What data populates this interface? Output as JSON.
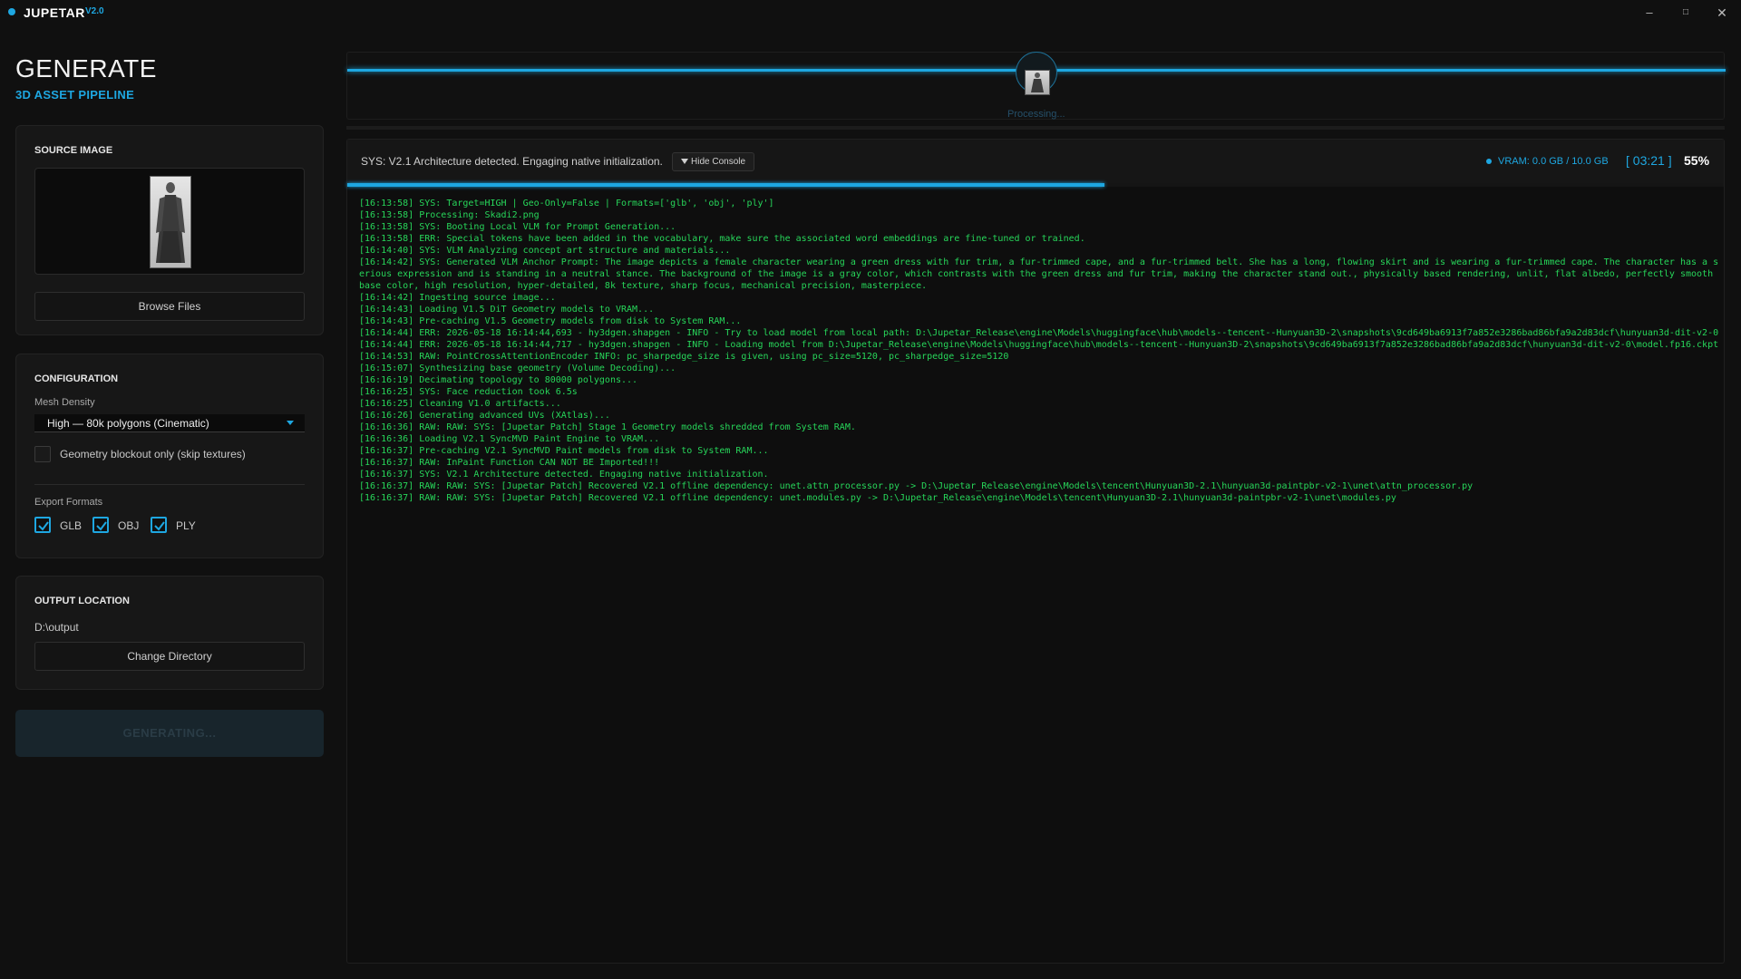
{
  "app": {
    "name": "JUPETAR",
    "version": "V2.0",
    "window_controls": [
      "–",
      "□",
      "✕"
    ]
  },
  "sidebar": {
    "title": "GENERATE",
    "subtitle": "3D ASSET PIPELINE",
    "source": {
      "title": "SOURCE IMAGE",
      "browse_label": "Browse Files"
    },
    "config": {
      "title": "CONFIGURATION",
      "mesh_density_label": "Mesh Density",
      "mesh_density_value": "High — 80k polygons (Cinematic)",
      "blockout_label": "Geometry blockout only (skip textures)",
      "blockout_checked": false,
      "export_label": "Export Formats",
      "formats": [
        {
          "label": "GLB",
          "checked": true
        },
        {
          "label": "OBJ",
          "checked": true
        },
        {
          "label": "PLY",
          "checked": true
        }
      ]
    },
    "output": {
      "title": "OUTPUT LOCATION",
      "path": "D:\\output",
      "change_label": "Change Directory"
    },
    "generate_label": "GENERATING..."
  },
  "strip": {
    "status": "Processing..."
  },
  "console": {
    "status": "SYS: V2.1 Architecture detected. Engaging native initialization.",
    "hide_label": "Hide Console",
    "vram": "VRAM: 0.0 GB / 10.0 GB",
    "timer": "[ 03:21 ]",
    "percent_label": "55%",
    "progress": 0.55,
    "accent": "#1ea7e1",
    "log_color": "#27d65a",
    "log": [
      "[16:13:58] SYS: Target=HIGH | Geo-Only=False | Formats=['glb', 'obj', 'ply']",
      "[16:13:58] Processing: Skadi2.png",
      "[16:13:58] SYS: Booting Local VLM for Prompt Generation...",
      "[16:13:58] ERR: Special tokens have been added in the vocabulary, make sure the associated word embeddings are fine-tuned or trained.",
      "[16:14:40] SYS: VLM Analyzing concept art structure and materials...",
      "[16:14:42] SYS: Generated VLM Anchor Prompt: The image depicts a female character wearing a green dress with fur trim, a fur-trimmed cape, and a fur-trimmed belt. She has a long, flowing skirt and is wearing a fur-trimmed cape. The character has a serious expression and is standing in a neutral stance. The background of the image is a gray color, which contrasts with the green dress and fur trim, making the character stand out., physically based rendering, unlit, flat albedo, perfectly smooth base color, high resolution, hyper-detailed, 8k texture, sharp focus, mechanical precision, masterpiece.",
      "[16:14:42] Ingesting source image...",
      "[16:14:43] Loading V1.5 DiT Geometry models to VRAM...",
      "[16:14:43] Pre-caching V1.5 Geometry models from disk to System RAM...",
      "[16:14:44] ERR: 2026-05-18 16:14:44,693 - hy3dgen.shapgen - INFO - Try to load model from local path: D:\\Jupetar_Release\\engine\\Models\\huggingface\\hub\\models--tencent--Hunyuan3D-2\\snapshots\\9cd649ba6913f7a852e3286bad86bfa9a2d83dcf\\hunyuan3d-dit-v2-0",
      "[16:14:44] ERR: 2026-05-18 16:14:44,717 - hy3dgen.shapgen - INFO - Loading model from D:\\Jupetar_Release\\engine\\Models\\huggingface\\hub\\models--tencent--Hunyuan3D-2\\snapshots\\9cd649ba6913f7a852e3286bad86bfa9a2d83dcf\\hunyuan3d-dit-v2-0\\model.fp16.ckpt",
      "[16:14:53] RAW: PointCrossAttentionEncoder INFO: pc_sharpedge_size is given, using pc_size=5120, pc_sharpedge_size=5120",
      "[16:15:07] Synthesizing base geometry (Volume Decoding)...",
      "[16:16:19] Decimating topology to 80000 polygons...",
      "[16:16:25] SYS: Face reduction took 6.5s",
      "[16:16:25] Cleaning V1.0 artifacts...",
      "[16:16:26] Generating advanced UVs (XAtlas)...",
      "[16:16:36] RAW: RAW: SYS: [Jupetar Patch] Stage 1 Geometry models shredded from System RAM.",
      "[16:16:36] Loading V2.1 SyncMVD Paint Engine to VRAM...",
      "[16:16:37] Pre-caching V2.1 SyncMVD Paint models from disk to System RAM...",
      "[16:16:37] RAW: InPaint Function CAN NOT BE Imported!!!",
      "[16:16:37] SYS: V2.1 Architecture detected. Engaging native initialization.",
      "[16:16:37] RAW: RAW: SYS: [Jupetar Patch] Recovered V2.1 offline dependency: unet.attn_processor.py -> D:\\Jupetar_Release\\engine\\Models\\tencent\\Hunyuan3D-2.1\\hunyuan3d-paintpbr-v2-1\\unet\\attn_processor.py",
      "[16:16:37] RAW: RAW: SYS: [Jupetar Patch] Recovered V2.1 offline dependency: unet.modules.py -> D:\\Jupetar_Release\\engine\\Models\\tencent\\Hunyuan3D-2.1\\hunyuan3d-paintpbr-v2-1\\unet\\modules.py"
    ]
  }
}
